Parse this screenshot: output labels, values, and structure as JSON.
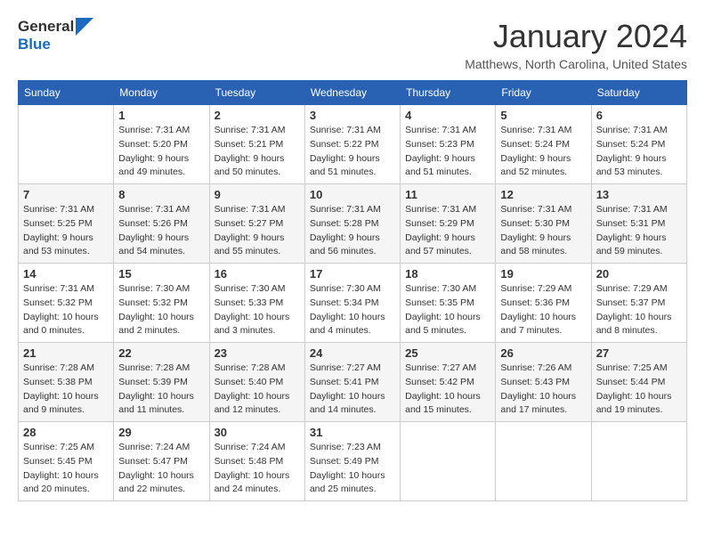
{
  "logo": {
    "line1": "General",
    "line2": "Blue"
  },
  "title": "January 2024",
  "location": "Matthews, North Carolina, United States",
  "weekdays": [
    "Sunday",
    "Monday",
    "Tuesday",
    "Wednesday",
    "Thursday",
    "Friday",
    "Saturday"
  ],
  "weeks": [
    [
      {
        "day": "",
        "info": ""
      },
      {
        "day": "1",
        "info": "Sunrise: 7:31 AM\nSunset: 5:20 PM\nDaylight: 9 hours\nand 49 minutes."
      },
      {
        "day": "2",
        "info": "Sunrise: 7:31 AM\nSunset: 5:21 PM\nDaylight: 9 hours\nand 50 minutes."
      },
      {
        "day": "3",
        "info": "Sunrise: 7:31 AM\nSunset: 5:22 PM\nDaylight: 9 hours\nand 51 minutes."
      },
      {
        "day": "4",
        "info": "Sunrise: 7:31 AM\nSunset: 5:23 PM\nDaylight: 9 hours\nand 51 minutes."
      },
      {
        "day": "5",
        "info": "Sunrise: 7:31 AM\nSunset: 5:24 PM\nDaylight: 9 hours\nand 52 minutes."
      },
      {
        "day": "6",
        "info": "Sunrise: 7:31 AM\nSunset: 5:24 PM\nDaylight: 9 hours\nand 53 minutes."
      }
    ],
    [
      {
        "day": "7",
        "info": "Sunrise: 7:31 AM\nSunset: 5:25 PM\nDaylight: 9 hours\nand 53 minutes."
      },
      {
        "day": "8",
        "info": "Sunrise: 7:31 AM\nSunset: 5:26 PM\nDaylight: 9 hours\nand 54 minutes."
      },
      {
        "day": "9",
        "info": "Sunrise: 7:31 AM\nSunset: 5:27 PM\nDaylight: 9 hours\nand 55 minutes."
      },
      {
        "day": "10",
        "info": "Sunrise: 7:31 AM\nSunset: 5:28 PM\nDaylight: 9 hours\nand 56 minutes."
      },
      {
        "day": "11",
        "info": "Sunrise: 7:31 AM\nSunset: 5:29 PM\nDaylight: 9 hours\nand 57 minutes."
      },
      {
        "day": "12",
        "info": "Sunrise: 7:31 AM\nSunset: 5:30 PM\nDaylight: 9 hours\nand 58 minutes."
      },
      {
        "day": "13",
        "info": "Sunrise: 7:31 AM\nSunset: 5:31 PM\nDaylight: 9 hours\nand 59 minutes."
      }
    ],
    [
      {
        "day": "14",
        "info": "Sunrise: 7:31 AM\nSunset: 5:32 PM\nDaylight: 10 hours\nand 0 minutes."
      },
      {
        "day": "15",
        "info": "Sunrise: 7:30 AM\nSunset: 5:32 PM\nDaylight: 10 hours\nand 2 minutes."
      },
      {
        "day": "16",
        "info": "Sunrise: 7:30 AM\nSunset: 5:33 PM\nDaylight: 10 hours\nand 3 minutes."
      },
      {
        "day": "17",
        "info": "Sunrise: 7:30 AM\nSunset: 5:34 PM\nDaylight: 10 hours\nand 4 minutes."
      },
      {
        "day": "18",
        "info": "Sunrise: 7:30 AM\nSunset: 5:35 PM\nDaylight: 10 hours\nand 5 minutes."
      },
      {
        "day": "19",
        "info": "Sunrise: 7:29 AM\nSunset: 5:36 PM\nDaylight: 10 hours\nand 7 minutes."
      },
      {
        "day": "20",
        "info": "Sunrise: 7:29 AM\nSunset: 5:37 PM\nDaylight: 10 hours\nand 8 minutes."
      }
    ],
    [
      {
        "day": "21",
        "info": "Sunrise: 7:28 AM\nSunset: 5:38 PM\nDaylight: 10 hours\nand 9 minutes."
      },
      {
        "day": "22",
        "info": "Sunrise: 7:28 AM\nSunset: 5:39 PM\nDaylight: 10 hours\nand 11 minutes."
      },
      {
        "day": "23",
        "info": "Sunrise: 7:28 AM\nSunset: 5:40 PM\nDaylight: 10 hours\nand 12 minutes."
      },
      {
        "day": "24",
        "info": "Sunrise: 7:27 AM\nSunset: 5:41 PM\nDaylight: 10 hours\nand 14 minutes."
      },
      {
        "day": "25",
        "info": "Sunrise: 7:27 AM\nSunset: 5:42 PM\nDaylight: 10 hours\nand 15 minutes."
      },
      {
        "day": "26",
        "info": "Sunrise: 7:26 AM\nSunset: 5:43 PM\nDaylight: 10 hours\nand 17 minutes."
      },
      {
        "day": "27",
        "info": "Sunrise: 7:25 AM\nSunset: 5:44 PM\nDaylight: 10 hours\nand 19 minutes."
      }
    ],
    [
      {
        "day": "28",
        "info": "Sunrise: 7:25 AM\nSunset: 5:45 PM\nDaylight: 10 hours\nand 20 minutes."
      },
      {
        "day": "29",
        "info": "Sunrise: 7:24 AM\nSunset: 5:47 PM\nDaylight: 10 hours\nand 22 minutes."
      },
      {
        "day": "30",
        "info": "Sunrise: 7:24 AM\nSunset: 5:48 PM\nDaylight: 10 hours\nand 24 minutes."
      },
      {
        "day": "31",
        "info": "Sunrise: 7:23 AM\nSunset: 5:49 PM\nDaylight: 10 hours\nand 25 minutes."
      },
      {
        "day": "",
        "info": ""
      },
      {
        "day": "",
        "info": ""
      },
      {
        "day": "",
        "info": ""
      }
    ]
  ]
}
